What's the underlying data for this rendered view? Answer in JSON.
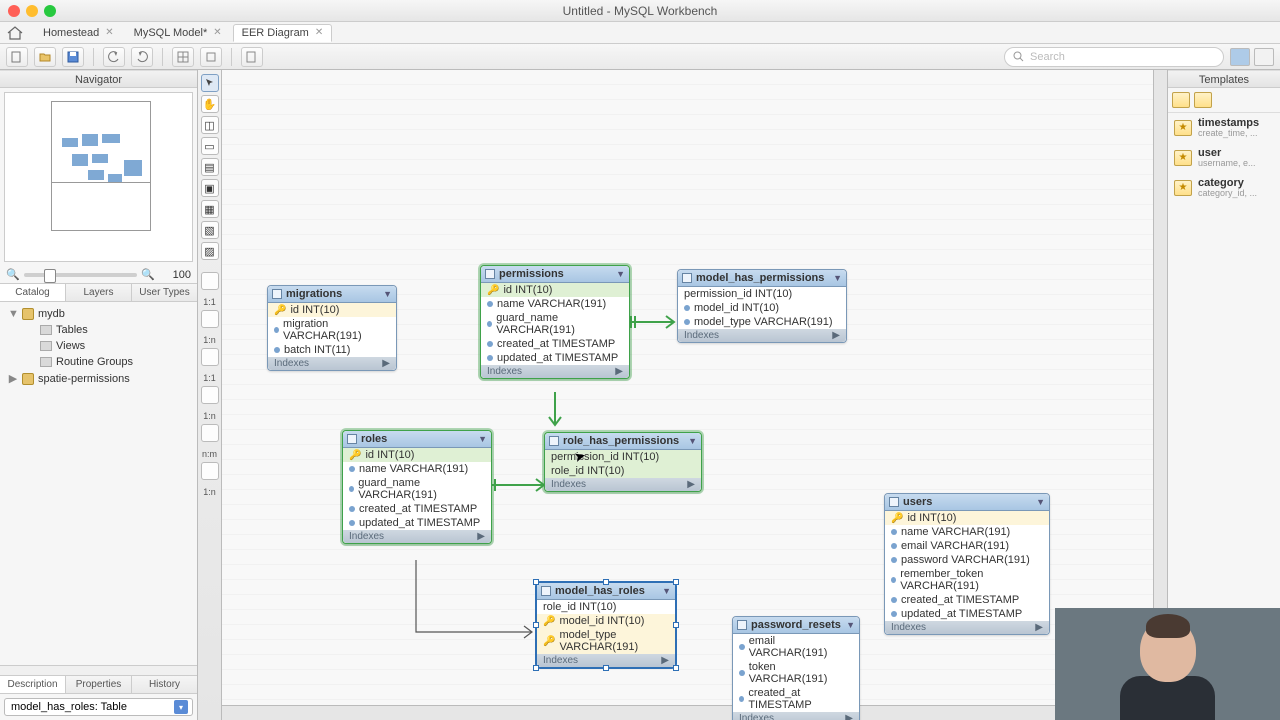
{
  "window": {
    "title": "Untitled - MySQL Workbench"
  },
  "doc_tabs": [
    {
      "label": "Homestead",
      "active": false
    },
    {
      "label": "MySQL Model*",
      "active": false
    },
    {
      "label": "EER Diagram",
      "active": true
    }
  ],
  "search_placeholder": "Search",
  "navigator": {
    "title": "Navigator",
    "zoom": "100",
    "sub_tabs": [
      "Catalog",
      "Layers",
      "User Types"
    ],
    "tree": {
      "db1": "mydb",
      "db1_children": [
        "Tables",
        "Views",
        "Routine Groups"
      ],
      "db2": "spatie-permissions"
    },
    "bottom_tabs": [
      "Description",
      "Properties",
      "History"
    ],
    "selected_object": "model_has_roles: Table"
  },
  "tool_labels": {
    "one_one_d": "1:1",
    "one_n_d": "1:n",
    "one_one": "1:1",
    "one_n": "1:n",
    "n_m": "n:m",
    "existing": "1:n"
  },
  "templates": {
    "title": "Templates",
    "items": [
      {
        "name": "timestamps",
        "sub": "create_time, ..."
      },
      {
        "name": "user",
        "sub": "username, e..."
      },
      {
        "name": "category",
        "sub": "category_id, ..."
      }
    ]
  },
  "entities": {
    "migrations": {
      "title": "migrations",
      "cols": [
        "id INT(10)",
        "migration VARCHAR(191)",
        "batch INT(11)"
      ],
      "pk_idx": [
        0
      ]
    },
    "permissions": {
      "title": "permissions",
      "cols": [
        "id INT(10)",
        "name VARCHAR(191)",
        "guard_name VARCHAR(191)",
        "created_at TIMESTAMP",
        "updated_at TIMESTAMP"
      ],
      "pk_idx": [
        0
      ]
    },
    "model_has_permissions": {
      "title": "model_has_permissions",
      "cols": [
        "permission_id INT(10)",
        "model_id INT(10)",
        "model_type VARCHAR(191)"
      ],
      "pk_idx": []
    },
    "roles": {
      "title": "roles",
      "cols": [
        "id INT(10)",
        "name VARCHAR(191)",
        "guard_name VARCHAR(191)",
        "created_at TIMESTAMP",
        "updated_at TIMESTAMP"
      ],
      "pk_idx": [
        0
      ]
    },
    "role_has_permissions": {
      "title": "role_has_permissions",
      "cols": [
        "permission_id INT(10)",
        "role_id INT(10)"
      ],
      "pk_idx": []
    },
    "model_has_roles": {
      "title": "model_has_roles",
      "cols": [
        "role_id INT(10)",
        "model_id INT(10)",
        "model_type VARCHAR(191)"
      ],
      "pk_idx": [
        1,
        2
      ]
    },
    "users": {
      "title": "users",
      "cols": [
        "id INT(10)",
        "name VARCHAR(191)",
        "email VARCHAR(191)",
        "password VARCHAR(191)",
        "remember_token VARCHAR(191)",
        "created_at TIMESTAMP",
        "updated_at TIMESTAMP"
      ],
      "pk_idx": [
        0
      ]
    },
    "password_resets": {
      "title": "password_resets",
      "cols": [
        "email VARCHAR(191)",
        "token VARCHAR(191)",
        "created_at TIMESTAMP"
      ],
      "pk_idx": []
    }
  },
  "indexes_label": "Indexes"
}
